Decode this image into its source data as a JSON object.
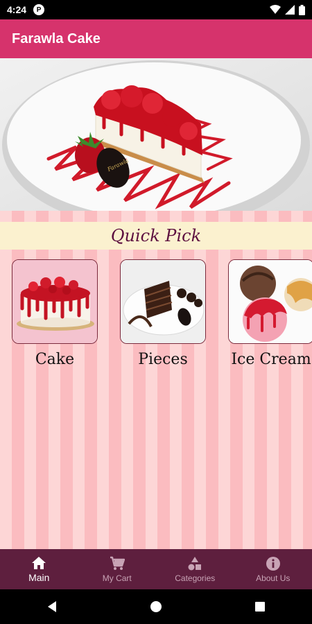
{
  "status_bar": {
    "time": "4:24",
    "notification_icon": "circle-badge-icon"
  },
  "app_bar": {
    "title": "Farawla Cake"
  },
  "carousel": {
    "dots": 5,
    "active": 1
  },
  "quick_pick": {
    "heading": "Quick Pick",
    "items": [
      {
        "label": "Cake",
        "image": "strawberry-cake-image"
      },
      {
        "label": "Pieces",
        "image": "chocolate-cake-slice-image"
      },
      {
        "label": "Ice Cream",
        "image": "ice-cream-scoops-image"
      }
    ]
  },
  "bottom_nav": {
    "items": [
      {
        "label": "Main",
        "icon": "home-icon",
        "active": true
      },
      {
        "label": "My Cart",
        "icon": "cart-icon",
        "active": false
      },
      {
        "label": "Categories",
        "icon": "categories-icon",
        "active": false
      },
      {
        "label": "About Us",
        "icon": "info-icon",
        "active": false
      }
    ]
  },
  "colors": {
    "app_bar": "#d6336c",
    "bottom_nav": "#5e1f3e",
    "quick_pick_band": "#fbf1cf",
    "stripe_light": "#fdd6d6",
    "stripe_dark": "#fbbcc0"
  }
}
